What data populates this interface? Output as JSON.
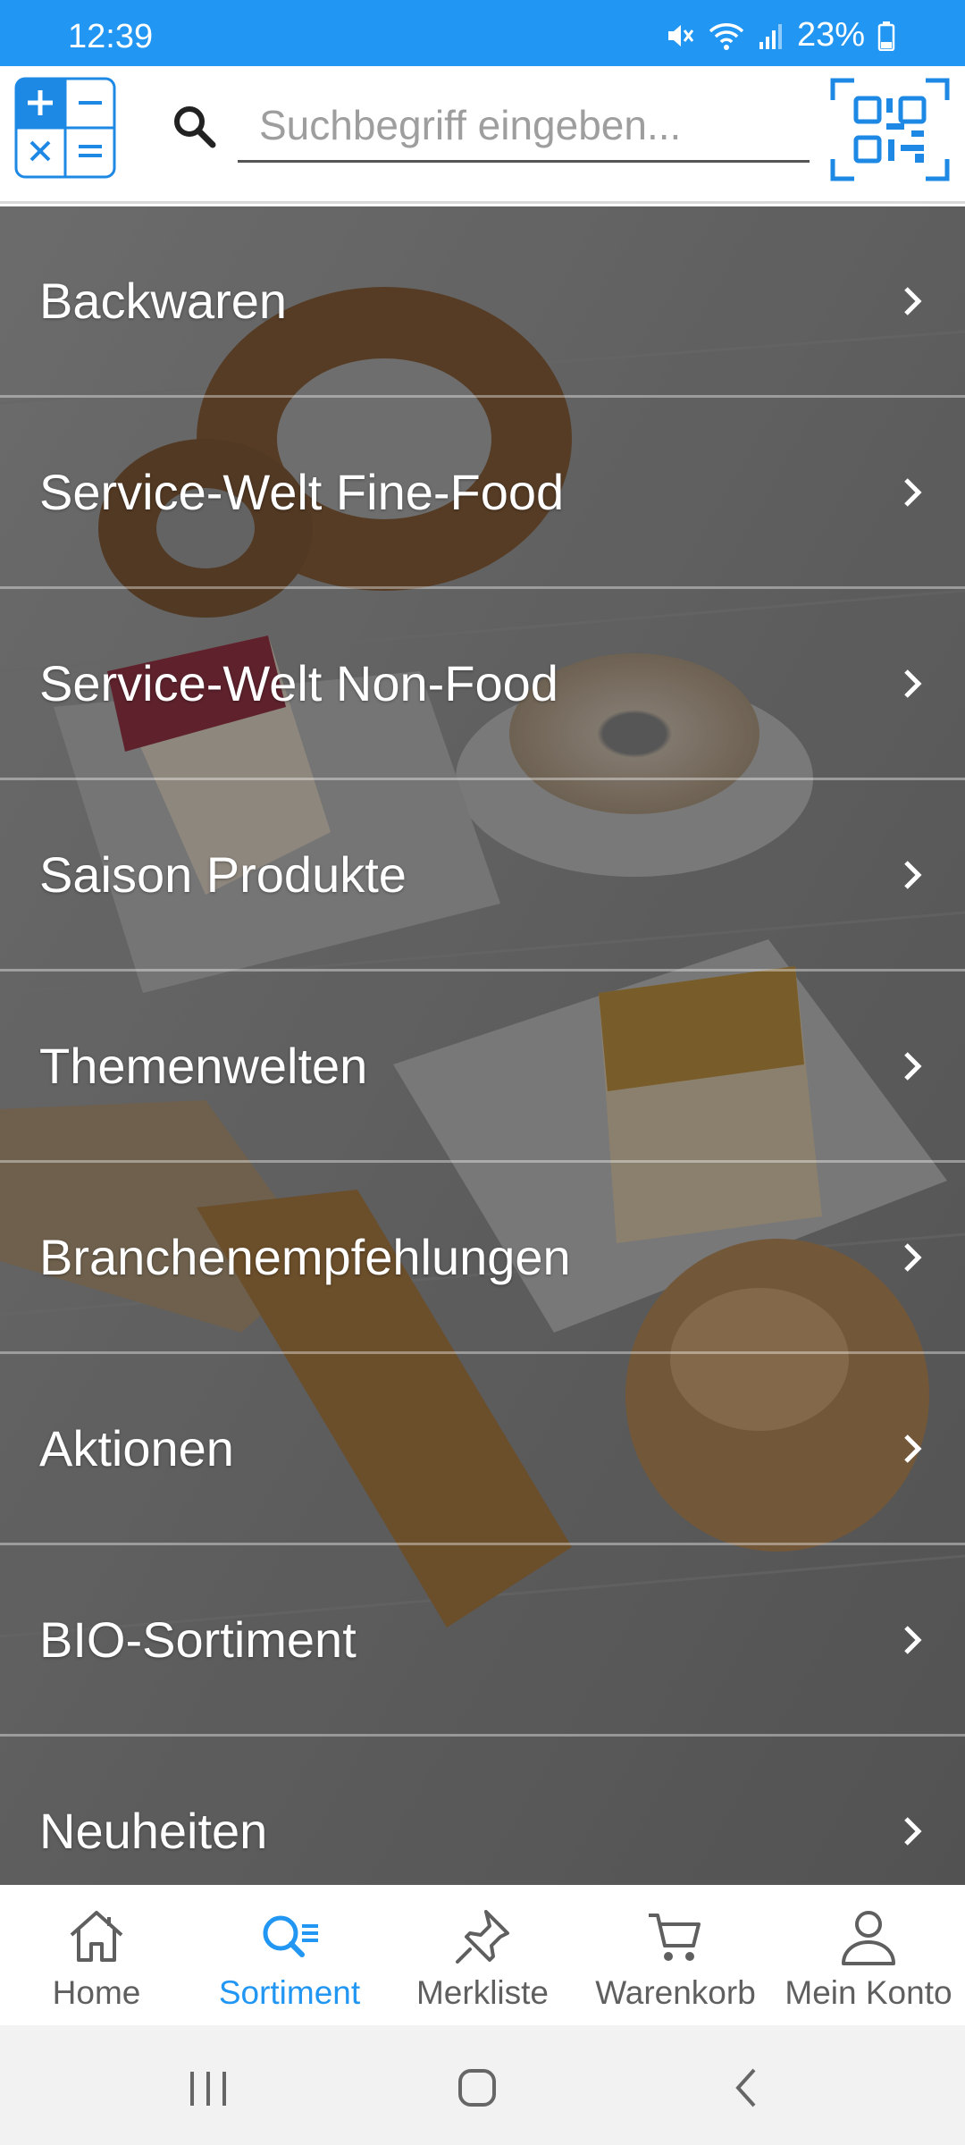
{
  "status_bar": {
    "time": "12:39",
    "battery": "23%",
    "icons": [
      "mute-icon",
      "wifi-icon",
      "signal-icon",
      "battery-icon"
    ]
  },
  "header": {
    "calculator_icon": "calculator-icon",
    "search": {
      "placeholder": "Suchbegriff eingeben...",
      "value": ""
    },
    "qr_icon": "qr-scan-icon"
  },
  "categories": [
    {
      "label": "Backwaren"
    },
    {
      "label": "Service-Welt Fine-Food"
    },
    {
      "label": "Service-Welt Non-Food"
    },
    {
      "label": "Saison Produkte"
    },
    {
      "label": "Themenwelten"
    },
    {
      "label": "Branchenempfehlungen"
    },
    {
      "label": "Aktionen"
    },
    {
      "label": "BIO-Sortiment"
    },
    {
      "label": "Neuheiten"
    }
  ],
  "bottom_nav": {
    "items": [
      {
        "label": "Home",
        "icon": "home-icon",
        "active": false
      },
      {
        "label": "Sortiment",
        "icon": "catalog-search-icon",
        "active": true
      },
      {
        "label": "Merkliste",
        "icon": "pin-icon",
        "active": false
      },
      {
        "label": "Warenkorb",
        "icon": "cart-icon",
        "active": false
      },
      {
        "label": "Mein Konto",
        "icon": "user-icon",
        "active": false
      }
    ]
  },
  "colors": {
    "accent": "#2196F3",
    "nav_inactive": "#5f5f5f",
    "overlay_text": "#ffffff"
  }
}
